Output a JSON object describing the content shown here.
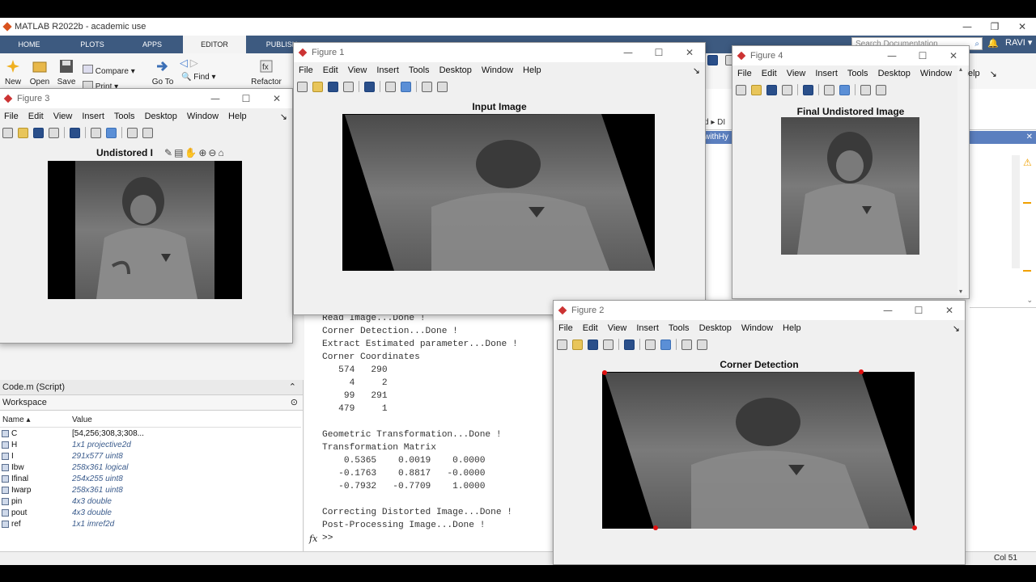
{
  "app": {
    "title": "MATLAB R2022b - academic use"
  },
  "tabs": [
    "HOME",
    "PLOTS",
    "APPS",
    "EDITOR",
    "PUBLISH"
  ],
  "ribbon": {
    "new": "New",
    "open": "Open",
    "save": "Save",
    "compare": "Compare",
    "print": "Print",
    "goto": "Go To",
    "find": "Find",
    "refactor": "Refactor"
  },
  "search": {
    "placeholder": "Search Documentation"
  },
  "user": {
    "name": "RAVI"
  },
  "path_fragment": "d ▸ DI",
  "editor_tab_fragment": "withHy",
  "figure_menu": [
    "File",
    "Edit",
    "View",
    "Insert",
    "Tools",
    "Desktop",
    "Window",
    "Help"
  ],
  "figures": {
    "fig1": {
      "title": "Figure 1",
      "axes_title": "Input Image"
    },
    "fig2": {
      "title": "Figure 2",
      "axes_title": "Corner Detection"
    },
    "fig3": {
      "title": "Figure 3",
      "axes_title": "Undistored I"
    },
    "fig4": {
      "title": "Figure 4",
      "axes_title": "Final Undistored Image"
    }
  },
  "command_window": {
    "lines": [
      "Read Image...Done !",
      "Corner Detection...Done !",
      "Extract Estimated parameter...Done !",
      "Corner Coordinates",
      "   574   290",
      "     4     2",
      "    99   291",
      "   479     1",
      "",
      "Geometric Transformation...Done !",
      "Transformation Matrix",
      "    0.5365    0.0019    0.0000",
      "   -0.1763    0.8817   -0.0000",
      "   -0.7932   -0.7709    1.0000",
      "",
      "Correcting Distorted Image...Done !",
      "Post-Processing Image...Done !"
    ],
    "prompt": ">>",
    "fx": "fx"
  },
  "editor_file": "Code.m (Script)",
  "workspace": {
    "title": "Workspace",
    "columns": [
      "Name",
      "Value"
    ],
    "rows": [
      {
        "name": "C",
        "value": "[54,256;308,3;308..."
      },
      {
        "name": "H",
        "value": "1x1 projective2d"
      },
      {
        "name": "I",
        "value": "291x577 uint8"
      },
      {
        "name": "Ibw",
        "value": "258x361 logical"
      },
      {
        "name": "Ifinal",
        "value": "254x255 uint8"
      },
      {
        "name": "Iwarp",
        "value": "258x361 uint8"
      },
      {
        "name": "pin",
        "value": "4x3 double"
      },
      {
        "name": "pout",
        "value": "4x3 double"
      },
      {
        "name": "ref",
        "value": "1x1 imref2d"
      }
    ]
  },
  "status": {
    "col": "Col 51"
  },
  "colors": {
    "tabstrip": "#3d5a80",
    "corner_marker": "#e01010",
    "warning": "#f0a000"
  }
}
